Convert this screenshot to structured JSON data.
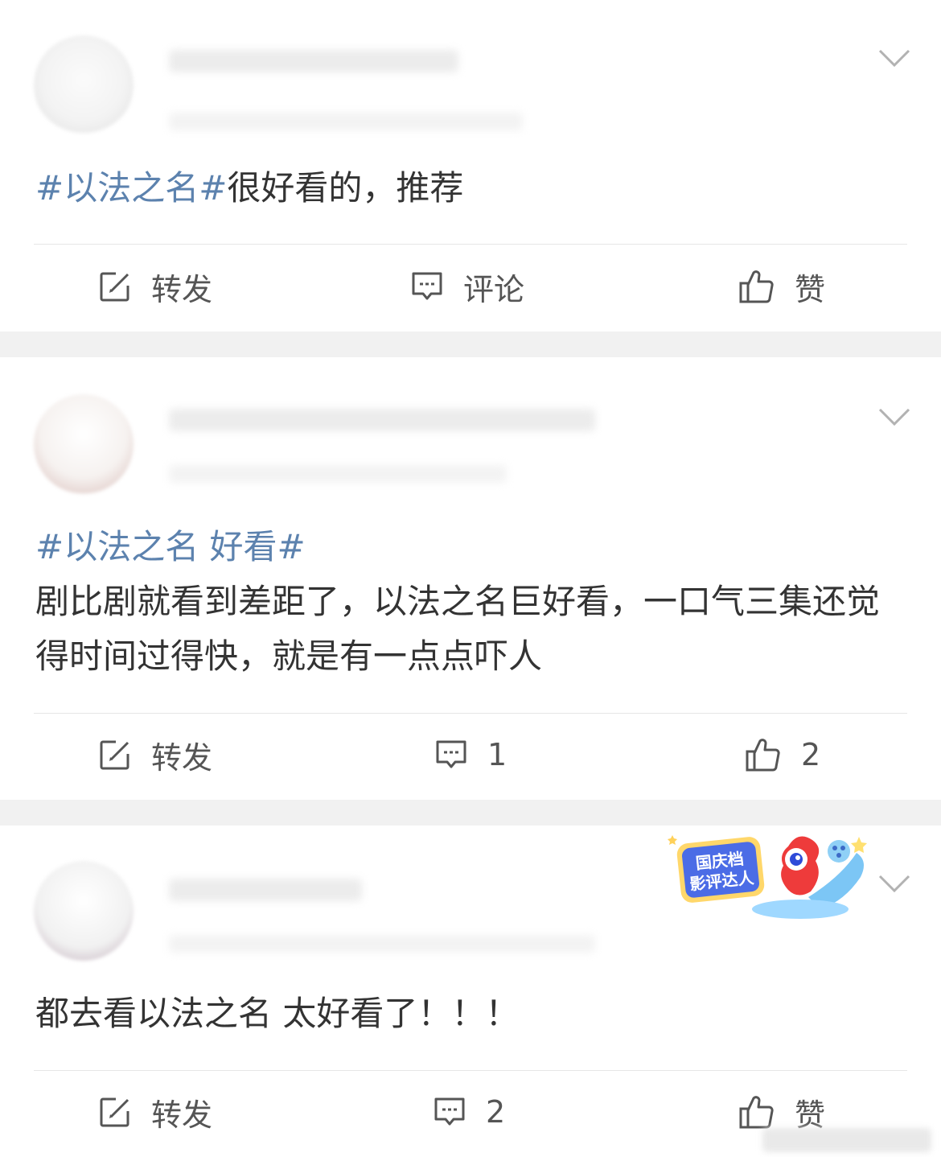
{
  "posts": [
    {
      "text_tag": "#以法之名#",
      "text_body": "很好看的，推荐",
      "actions": {
        "repost": "转发",
        "comment": "评论",
        "like": "赞"
      }
    },
    {
      "text_tag": "#以法之名 好看#",
      "text_body": "剧比剧就看到差距了，以法之名巨好看，一口气三集还觉得时间过得快，就是有一点点吓人",
      "actions": {
        "repost": "转发",
        "comment": "1",
        "like": "2"
      }
    },
    {
      "text_tag": "",
      "text_body": "都去看以法之名 太好看了！！！",
      "actions": {
        "repost": "转发",
        "comment": "2",
        "like": "赞"
      },
      "badge": {
        "line1": "国庆档",
        "line2": "影评达人"
      }
    }
  ],
  "icons": {
    "repost": "edit-square-icon",
    "comment": "comment-bubble-icon",
    "like": "thumbs-up-icon",
    "menu": "chevron-down-icon"
  },
  "colors": {
    "topic": "#5c82ae",
    "text": "#333333",
    "icon": "#555555",
    "separator": "#f1f1f1",
    "divider": "#e6e6e6"
  }
}
